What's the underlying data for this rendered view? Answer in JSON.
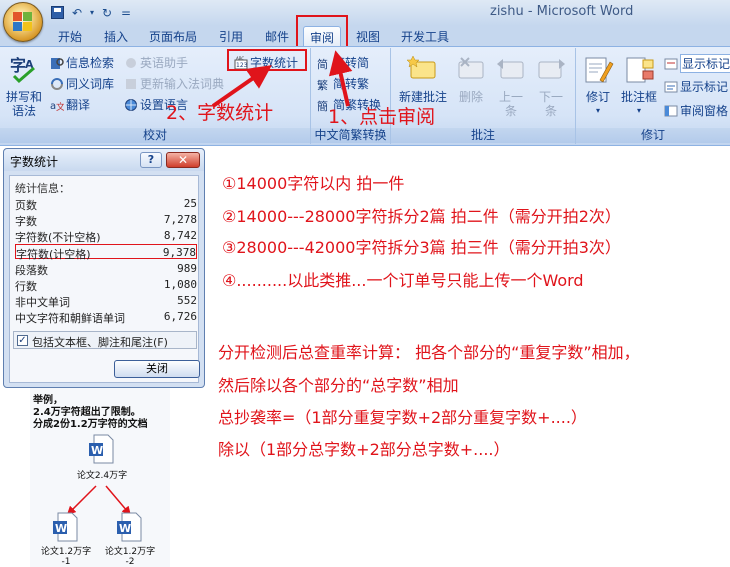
{
  "window": {
    "title": "zishu - Microsoft Word"
  },
  "quick_access": {
    "save": "save-icon",
    "undo": "undo-icon",
    "redo": "redo-icon",
    "customize": "="
  },
  "tabs": [
    "开始",
    "插入",
    "页面布局",
    "引用",
    "邮件",
    "审阅",
    "视图",
    "开发工具"
  ],
  "active_tab": "审阅",
  "ribbon": {
    "proofing": {
      "label": "校对",
      "spelling": [
        "拼写和",
        "语法"
      ],
      "research": "信息检索",
      "thesaurus": "同义词库",
      "translate": "翻译",
      "english_assistant": "英语助手",
      "word_count": "字数统计",
      "update_ime": "更新输入法词典",
      "set_language": "设置语言"
    },
    "chinese_conversion": {
      "label": "中文简繁转换",
      "to_simplified": "繁转简",
      "to_traditional": "简转繁",
      "convert": "简繁转换"
    },
    "comments": {
      "label": "批注",
      "new_comment": [
        "新建批注"
      ],
      "delete": "删除",
      "previous": [
        "上一",
        "条"
      ],
      "next": [
        "下一",
        "条"
      ]
    },
    "tracking": {
      "label": "修订",
      "track_changes": "修订",
      "balloons": "批注框",
      "show_markup_1": "显示标记",
      "show_markup_2": "显示标记",
      "reviewing_pane": "审阅窗格"
    }
  },
  "annotations": {
    "step1": "1、点击审阅",
    "step2": "2、字数统计"
  },
  "dialog": {
    "title": "字数统计",
    "help": "?",
    "close_glyph": "✕",
    "stats_header": "统计信息：",
    "stats": [
      {
        "label": "页数",
        "value": "25"
      },
      {
        "label": "字数",
        "value": "7,278"
      },
      {
        "label": "字符数(不计空格)",
        "value": "8,742"
      },
      {
        "label": "字符数(计空格)",
        "value": "9,378"
      },
      {
        "label": "段落数",
        "value": "989"
      },
      {
        "label": "行数",
        "value": "1,080"
      },
      {
        "label": "非中文单词",
        "value": "552"
      },
      {
        "label": "中文字符和朝鲜语单词",
        "value": "6,726"
      }
    ],
    "include_checkbox": "包括文本框、脚注和尾注(F)",
    "include_checked": true,
    "close_button": "关闭"
  },
  "diagram": {
    "heading1": "举例，",
    "heading2": "2.4万字符超出了限制。",
    "heading3": "分成2份1.2万字符的文档",
    "root_label": "论文2.4万字",
    "child1": [
      "论文1.2万字",
      "-1"
    ],
    "child2": [
      "论文1.2万字",
      "-2"
    ]
  },
  "instructions": {
    "rule1": "①14000字符以内 拍一件",
    "rule2": "②14000---28000字符拆分2篇 拍二件（需分开拍2次）",
    "rule3": "③28000---42000字符拆分3篇 拍三件（需分开拍3次）",
    "rule4": "④..........以此类推...一个订单号只能上传一个Word",
    "calc1": "分开检测后总查重率计算： 把各个部分的“重复字数”相加，",
    "calc2": "然后除以各个部分的“总字数”相加",
    "calc3": "总抄袭率=（1部分重复字数+2部分重复字数+....）",
    "calc4": "除以（1部分总字数+2部分总字数+....）"
  },
  "colors": {
    "annotation_red": "#e0141b",
    "ribbon_text": "#15428b"
  }
}
